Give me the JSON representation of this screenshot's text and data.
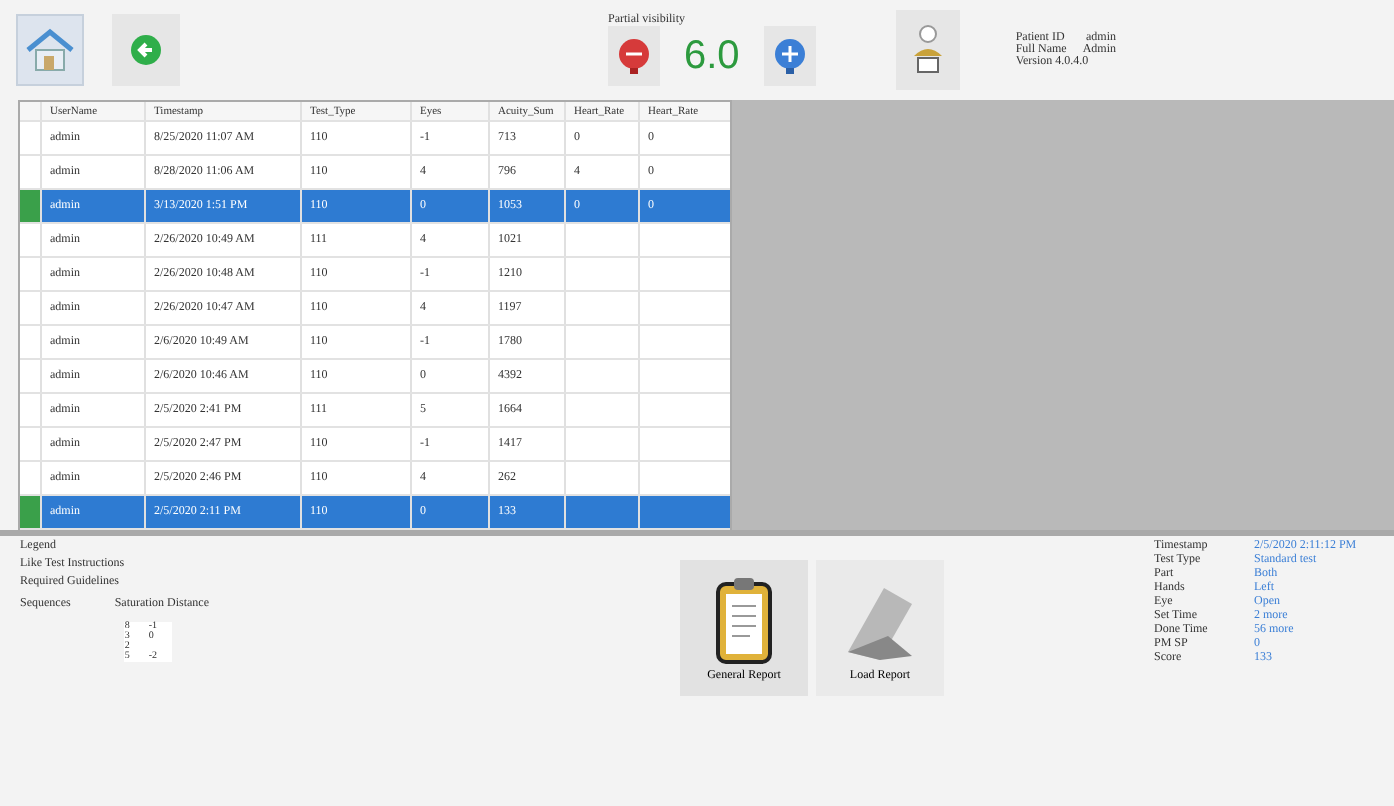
{
  "toolbar": {
    "visibility_label": "Partial visibility",
    "value": "6.0"
  },
  "user_info": [
    {
      "label": "Patient ID",
      "value": "admin"
    },
    {
      "label": "Full Name",
      "value": "Admin"
    },
    {
      "label": "Version 4.0.4.0"
    }
  ],
  "table": {
    "columns": [
      "UserName",
      "Timestamp",
      "Test_Type",
      "Eyes",
      "Acuity_Sum",
      "Heart_Rate",
      "Heart_Rate"
    ],
    "rows": [
      {
        "selected": false,
        "cells": [
          "admin",
          "8/25/2020 11:07 AM",
          "110",
          "-1",
          "713",
          "0",
          "0"
        ]
      },
      {
        "selected": false,
        "cells": [
          "admin",
          "8/28/2020 11:06 AM",
          "110",
          "4",
          "796",
          "4",
          "0"
        ]
      },
      {
        "selected": true,
        "cells": [
          "admin",
          "3/13/2020 1:51 PM",
          "110",
          "0",
          "1053",
          "0",
          "0"
        ]
      },
      {
        "selected": false,
        "cells": [
          "admin",
          "2/26/2020 10:49 AM",
          "111",
          "4",
          "1021",
          "",
          ""
        ]
      },
      {
        "selected": false,
        "cells": [
          "admin",
          "2/26/2020 10:48 AM",
          "110",
          "-1",
          "1210",
          "",
          ""
        ]
      },
      {
        "selected": false,
        "cells": [
          "admin",
          "2/26/2020 10:47 AM",
          "110",
          "4",
          "1197",
          "",
          ""
        ]
      },
      {
        "selected": false,
        "cells": [
          "admin",
          "2/6/2020 10:49 AM",
          "110",
          "-1",
          "1780",
          "",
          ""
        ]
      },
      {
        "selected": false,
        "cells": [
          "admin",
          "2/6/2020 10:46 AM",
          "110",
          "0",
          "4392",
          "",
          ""
        ]
      },
      {
        "selected": false,
        "cells": [
          "admin",
          "2/5/2020 2:41 PM",
          "111",
          "5",
          "1664",
          "",
          ""
        ]
      },
      {
        "selected": false,
        "cells": [
          "admin",
          "2/5/2020 2:47 PM",
          "110",
          "-1",
          "1417",
          "",
          ""
        ]
      },
      {
        "selected": false,
        "cells": [
          "admin",
          "2/5/2020 2:46 PM",
          "110",
          "4",
          "262",
          "",
          ""
        ]
      },
      {
        "selected": true,
        "cells": [
          "admin",
          "2/5/2020 2:11 PM",
          "110",
          "0",
          "133",
          "",
          ""
        ]
      }
    ]
  },
  "legend": {
    "title": "Legend",
    "lines": [
      "Like Test Instructions",
      "Required Guidelines"
    ],
    "sequences_label": "Sequences",
    "distance_label": "Saturation Distance",
    "grid": [
      [
        "8",
        "-1"
      ],
      [
        "3",
        "0"
      ],
      [
        "2"
      ],
      [
        "5",
        "-2"
      ]
    ]
  },
  "reports": [
    {
      "kind": "clipboard",
      "label": "General Report"
    },
    {
      "kind": "folder",
      "label": "Load Report"
    }
  ],
  "details": [
    {
      "label": "Timestamp",
      "value": "2/5/2020 2:11:12 PM"
    },
    {
      "label": "Test Type",
      "value": "Standard test"
    },
    {
      "label": "Part",
      "value": "Both"
    },
    {
      "label": "Hands",
      "value": "Left"
    },
    {
      "label": "Eye",
      "value": "Open"
    },
    {
      "label": "Set Time",
      "value": "2 more"
    },
    {
      "label": "Done Time",
      "value": "56 more"
    },
    {
      "label": "PM SP",
      "value": "0"
    },
    {
      "label": "Score",
      "value": "133"
    }
  ]
}
